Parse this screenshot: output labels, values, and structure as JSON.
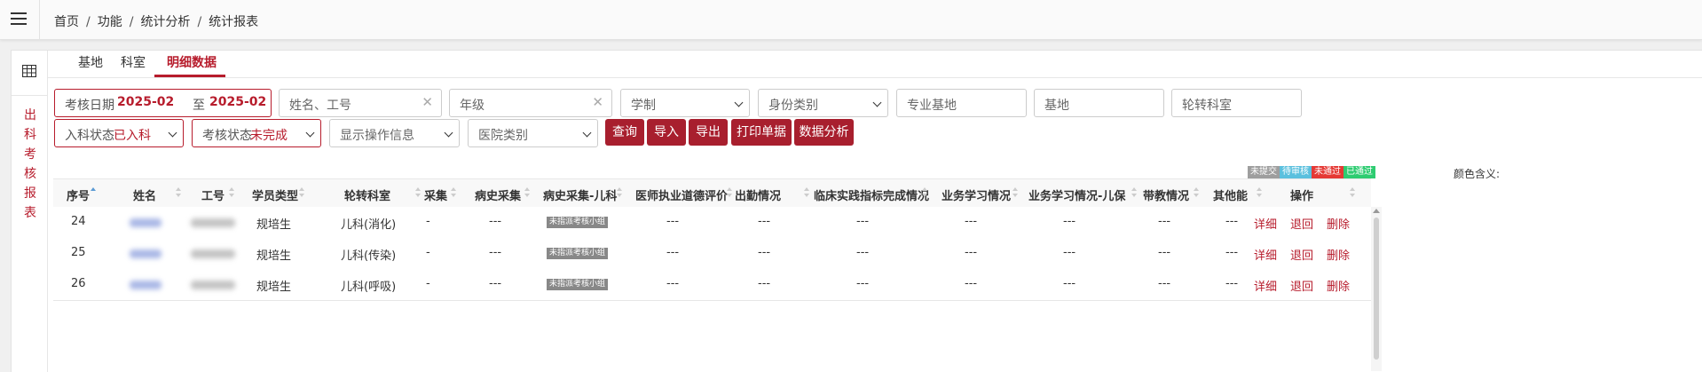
{
  "breadcrumb": [
    "首页",
    "功能",
    "统计分析",
    "统计报表"
  ],
  "side_vertical_text": [
    "出",
    "科",
    "考",
    "核",
    "报",
    "表"
  ],
  "tabs": [
    {
      "label": "基地",
      "active": false
    },
    {
      "label": "科室",
      "active": false
    },
    {
      "label": "明细数据",
      "active": true
    }
  ],
  "filters": {
    "date_label": "考核日期",
    "date_from": "2025-02",
    "date_sep": "至",
    "date_to": "2025-02",
    "name_placeholder": "姓名、工号",
    "grade_placeholder": "年级",
    "schooling_placeholder": "学制",
    "identity_placeholder": "身份类别",
    "major_base_placeholder": "专业基地",
    "base_placeholder": "基地",
    "rotation_dept_placeholder": "轮转科室",
    "admission_label": "入科状态",
    "admission_value": "已入科",
    "exam_label": "考核状态",
    "exam_value": "未完成",
    "show_ops_placeholder": "显示操作信息",
    "hospital_type_placeholder": "医院类别"
  },
  "buttons": {
    "query": "查询",
    "import": "导入",
    "export": "导出",
    "print": "打印单据",
    "analysis": "数据分析"
  },
  "legend": {
    "label": "颜色含义:",
    "items": [
      {
        "label": "未提交",
        "color": "#9e9e9e"
      },
      {
        "label": "待审核",
        "color": "#5bc0de"
      },
      {
        "label": "未通过",
        "color": "#e53935"
      },
      {
        "label": "已通过",
        "color": "#2ecc71"
      }
    ]
  },
  "table": {
    "headers": [
      "序号",
      "姓名",
      "工号",
      "学员类型",
      "轮转科室",
      "采集",
      "病史采集",
      "病史采集-儿科",
      "医师执业道德评价",
      "出勤情况",
      "临床实践指标完成情况",
      "业务学习情况",
      "业务学习情况-儿保",
      "带教情况",
      "其他能",
      "操作"
    ],
    "rows": [
      {
        "seq": "24",
        "type": "规培生",
        "dept": "儿科(消化)",
        "collect": "-",
        "history": "---",
        "tag": "未指派考核小组",
        "ethics": "---",
        "attend": "---",
        "clinical": "---",
        "study": "---",
        "study_child": "---",
        "teach": "---",
        "other": "---"
      },
      {
        "seq": "25",
        "type": "规培生",
        "dept": "儿科(传染)",
        "collect": "-",
        "history": "---",
        "tag": "未指派考核小组",
        "ethics": "---",
        "attend": "---",
        "clinical": "---",
        "study": "---",
        "study_child": "---",
        "teach": "---",
        "other": "---"
      },
      {
        "seq": "26",
        "type": "规培生",
        "dept": "儿科(呼吸)",
        "collect": "-",
        "history": "---",
        "tag": "未指派考核小组",
        "ethics": "---",
        "attend": "---",
        "clinical": "---",
        "study": "---",
        "study_child": "---",
        "teach": "---",
        "other": "---"
      }
    ],
    "actions": {
      "detail": "详细",
      "back": "退回",
      "delete": "删除"
    }
  },
  "colors": {
    "brand": "#a81f2e",
    "accent_text": "#b71c2c",
    "sort_active": "#5b9bd5"
  }
}
